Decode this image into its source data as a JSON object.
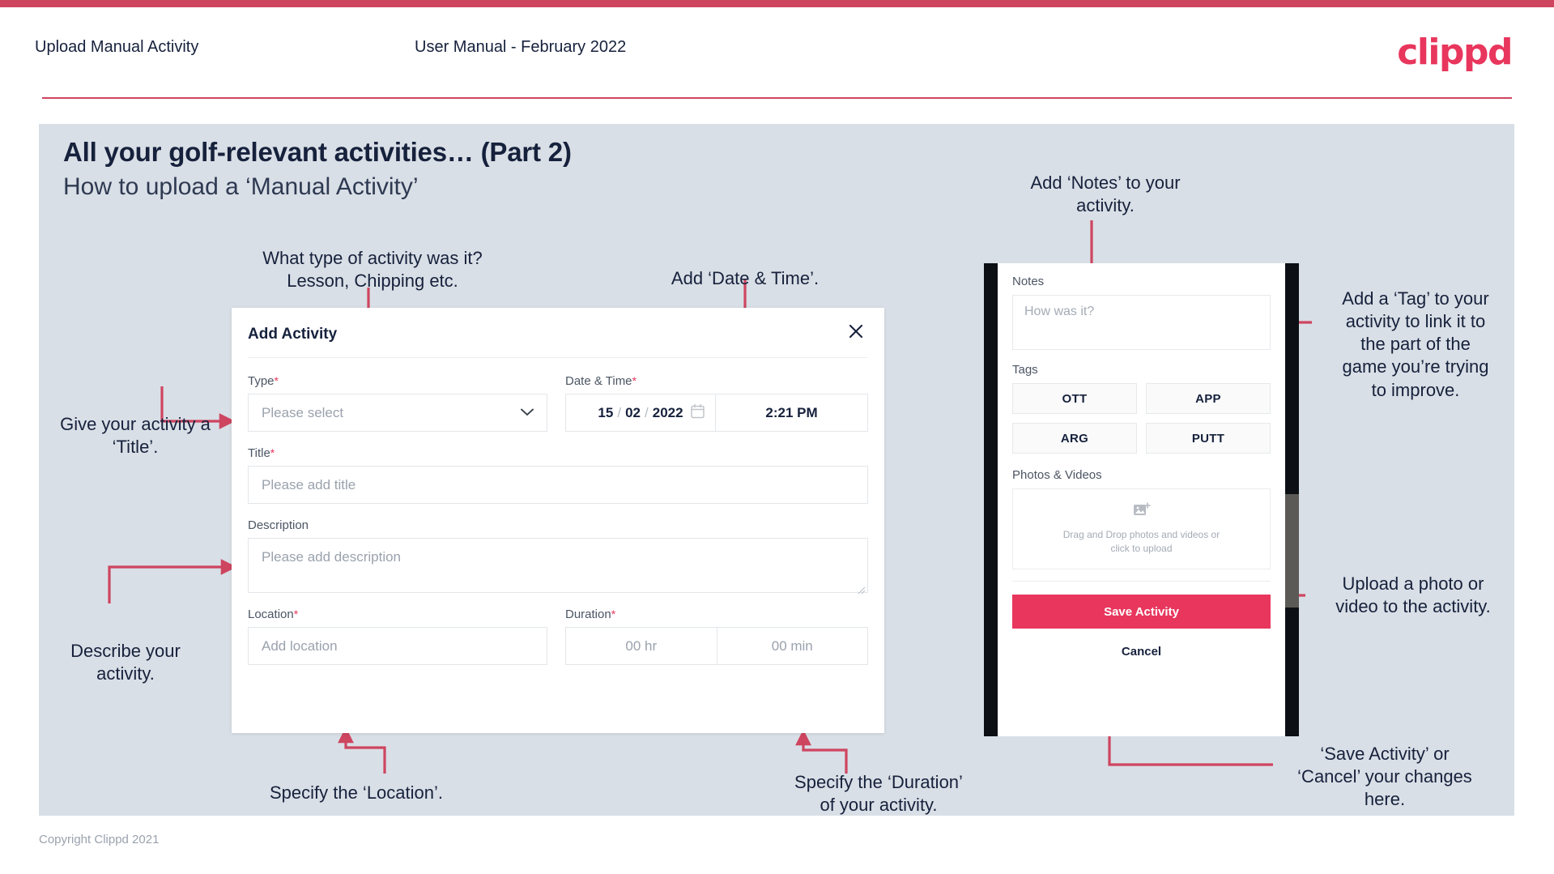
{
  "header": {
    "left_title": "Upload Manual Activity",
    "center_title": "User Manual - February 2022",
    "logo": "clippd"
  },
  "slide": {
    "title_line1": "All your golf-relevant activities… (Part 2)",
    "title_line2": "How to upload a ‘Manual Activity’"
  },
  "annotations": {
    "type": "What type of activity was it?\nLesson, Chipping etc.",
    "datetime": "Add ‘Date & Time’.",
    "title": "Give your activity a\n‘Title’.",
    "description": "Describe your\nactivity.",
    "location": "Specify the ‘Location’.",
    "duration": "Specify the ‘Duration’\nof your activity.",
    "notes": "Add ‘Notes’ to your\nactivity.",
    "tags": "Add a ‘Tag’ to your\nactivity to link it to\nthe part of the\ngame you’re trying\nto improve.",
    "upload": "Upload a photo or\nvideo to the activity.",
    "save": "‘Save Activity’ or\n‘Cancel’ your changes\nhere."
  },
  "dialog": {
    "title": "Add Activity",
    "close_icon": "close-icon",
    "fields": {
      "type_label": "Type",
      "type_placeholder": "Please select",
      "datetime_label": "Date & Time",
      "date_day": "15",
      "date_month": "02",
      "date_year": "2022",
      "date_sep": "/",
      "time_value": "2:21 PM",
      "title_label": "Title",
      "title_placeholder": "Please add title",
      "description_label": "Description",
      "description_placeholder": "Please add description",
      "location_label": "Location",
      "location_placeholder": "Add location",
      "duration_label": "Duration",
      "duration_hr_placeholder": "00 hr",
      "duration_min_placeholder": "00 min"
    },
    "required_marker": "*"
  },
  "phone": {
    "notes_label": "Notes",
    "notes_placeholder": "How was it?",
    "tags_label": "Tags",
    "tags": [
      "OTT",
      "APP",
      "ARG",
      "PUTT"
    ],
    "photos_label": "Photos & Videos",
    "drop_line1": "Drag and Drop photos and videos or",
    "drop_line2": "click to upload",
    "save_label": "Save Activity",
    "cancel_label": "Cancel"
  },
  "footer": {
    "copyright": "Copyright Clippd 2021"
  },
  "colors": {
    "accent": "#e8365d",
    "arrow": "#ce4560",
    "slide_bg": "#d9dfe6",
    "text_dark": "#16213c"
  }
}
